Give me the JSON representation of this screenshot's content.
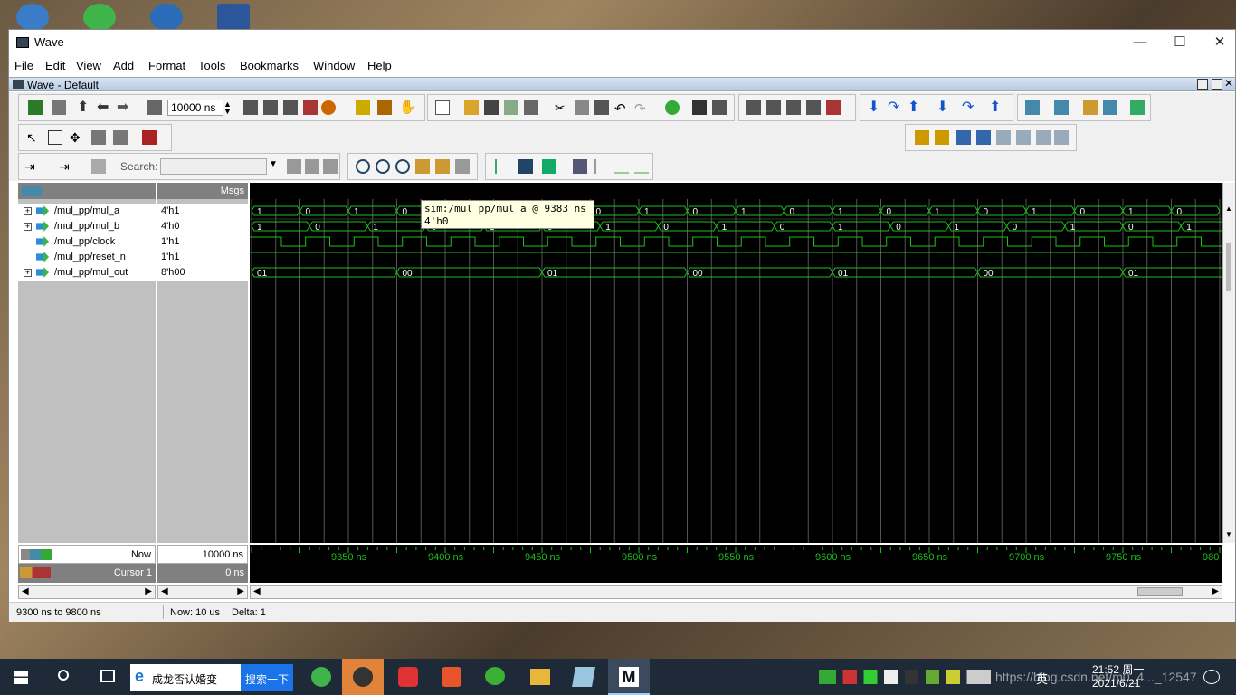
{
  "window": {
    "title": "Wave",
    "subtitle": "Wave - Default"
  },
  "menu": [
    "File",
    "Edit",
    "View",
    "Add",
    "Format",
    "Tools",
    "Bookmarks",
    "Window",
    "Help"
  ],
  "toolbar": {
    "time_value": "10000 ns",
    "search_label": "Search:",
    "search_placeholder": ""
  },
  "panes": {
    "msgs_header": "Msgs"
  },
  "signals": [
    {
      "name": "/mul_pp/mul_a",
      "value": "4'h1",
      "expandable": true
    },
    {
      "name": "/mul_pp/mul_b",
      "value": "4'h0",
      "expandable": true
    },
    {
      "name": "/mul_pp/clock",
      "value": "1'h1",
      "expandable": false
    },
    {
      "name": "/mul_pp/reset_n",
      "value": "1'h1",
      "expandable": false
    },
    {
      "name": "/mul_pp/mul_out",
      "value": "8'h00",
      "expandable": true
    }
  ],
  "waves": {
    "mul_a": [
      "1",
      "0",
      "1",
      "0",
      "1",
      "0",
      "1",
      "0",
      "1",
      "0",
      "1",
      "0",
      "1",
      "0",
      "1",
      "0",
      "1",
      "0",
      "1",
      "0"
    ],
    "mul_b": [
      "1",
      "0",
      "1",
      "0",
      "1",
      "0",
      "1",
      "0",
      "1",
      "0",
      "1",
      "0",
      "1",
      "0",
      "1",
      "0",
      "1"
    ],
    "mul_out": [
      "01",
      "00",
      "01",
      "00",
      "01",
      "00",
      "01"
    ]
  },
  "tooltip": {
    "line1": "sim:/mul_pp/mul_a @ 9383 ns",
    "line2": "4'h0"
  },
  "cursor": {
    "now_label": "Now",
    "now_value": "10000 ns",
    "cursor_label": "Cursor 1",
    "cursor_value": "0 ns"
  },
  "timeline": [
    "9350 ns",
    "9400 ns",
    "9450 ns",
    "9500 ns",
    "9550 ns",
    "9600 ns",
    "9650 ns",
    "9700 ns",
    "9750 ns",
    "980"
  ],
  "status": {
    "range": "9300 ns to 9800 ns",
    "now": "Now: 10 us",
    "delta": "Delta: 1"
  },
  "taskbar": {
    "ie_text": "成龙否认婚变",
    "search_button": "搜索一下",
    "time": "21:52 周一",
    "date": "2021/6/21",
    "ime": "英",
    "watermark": "https://blog.csdn.net/m0_4..._12547"
  },
  "colors": {
    "wave_green": "#1dbf1d",
    "grid": "#555555",
    "title_bg": "#ffffff"
  }
}
